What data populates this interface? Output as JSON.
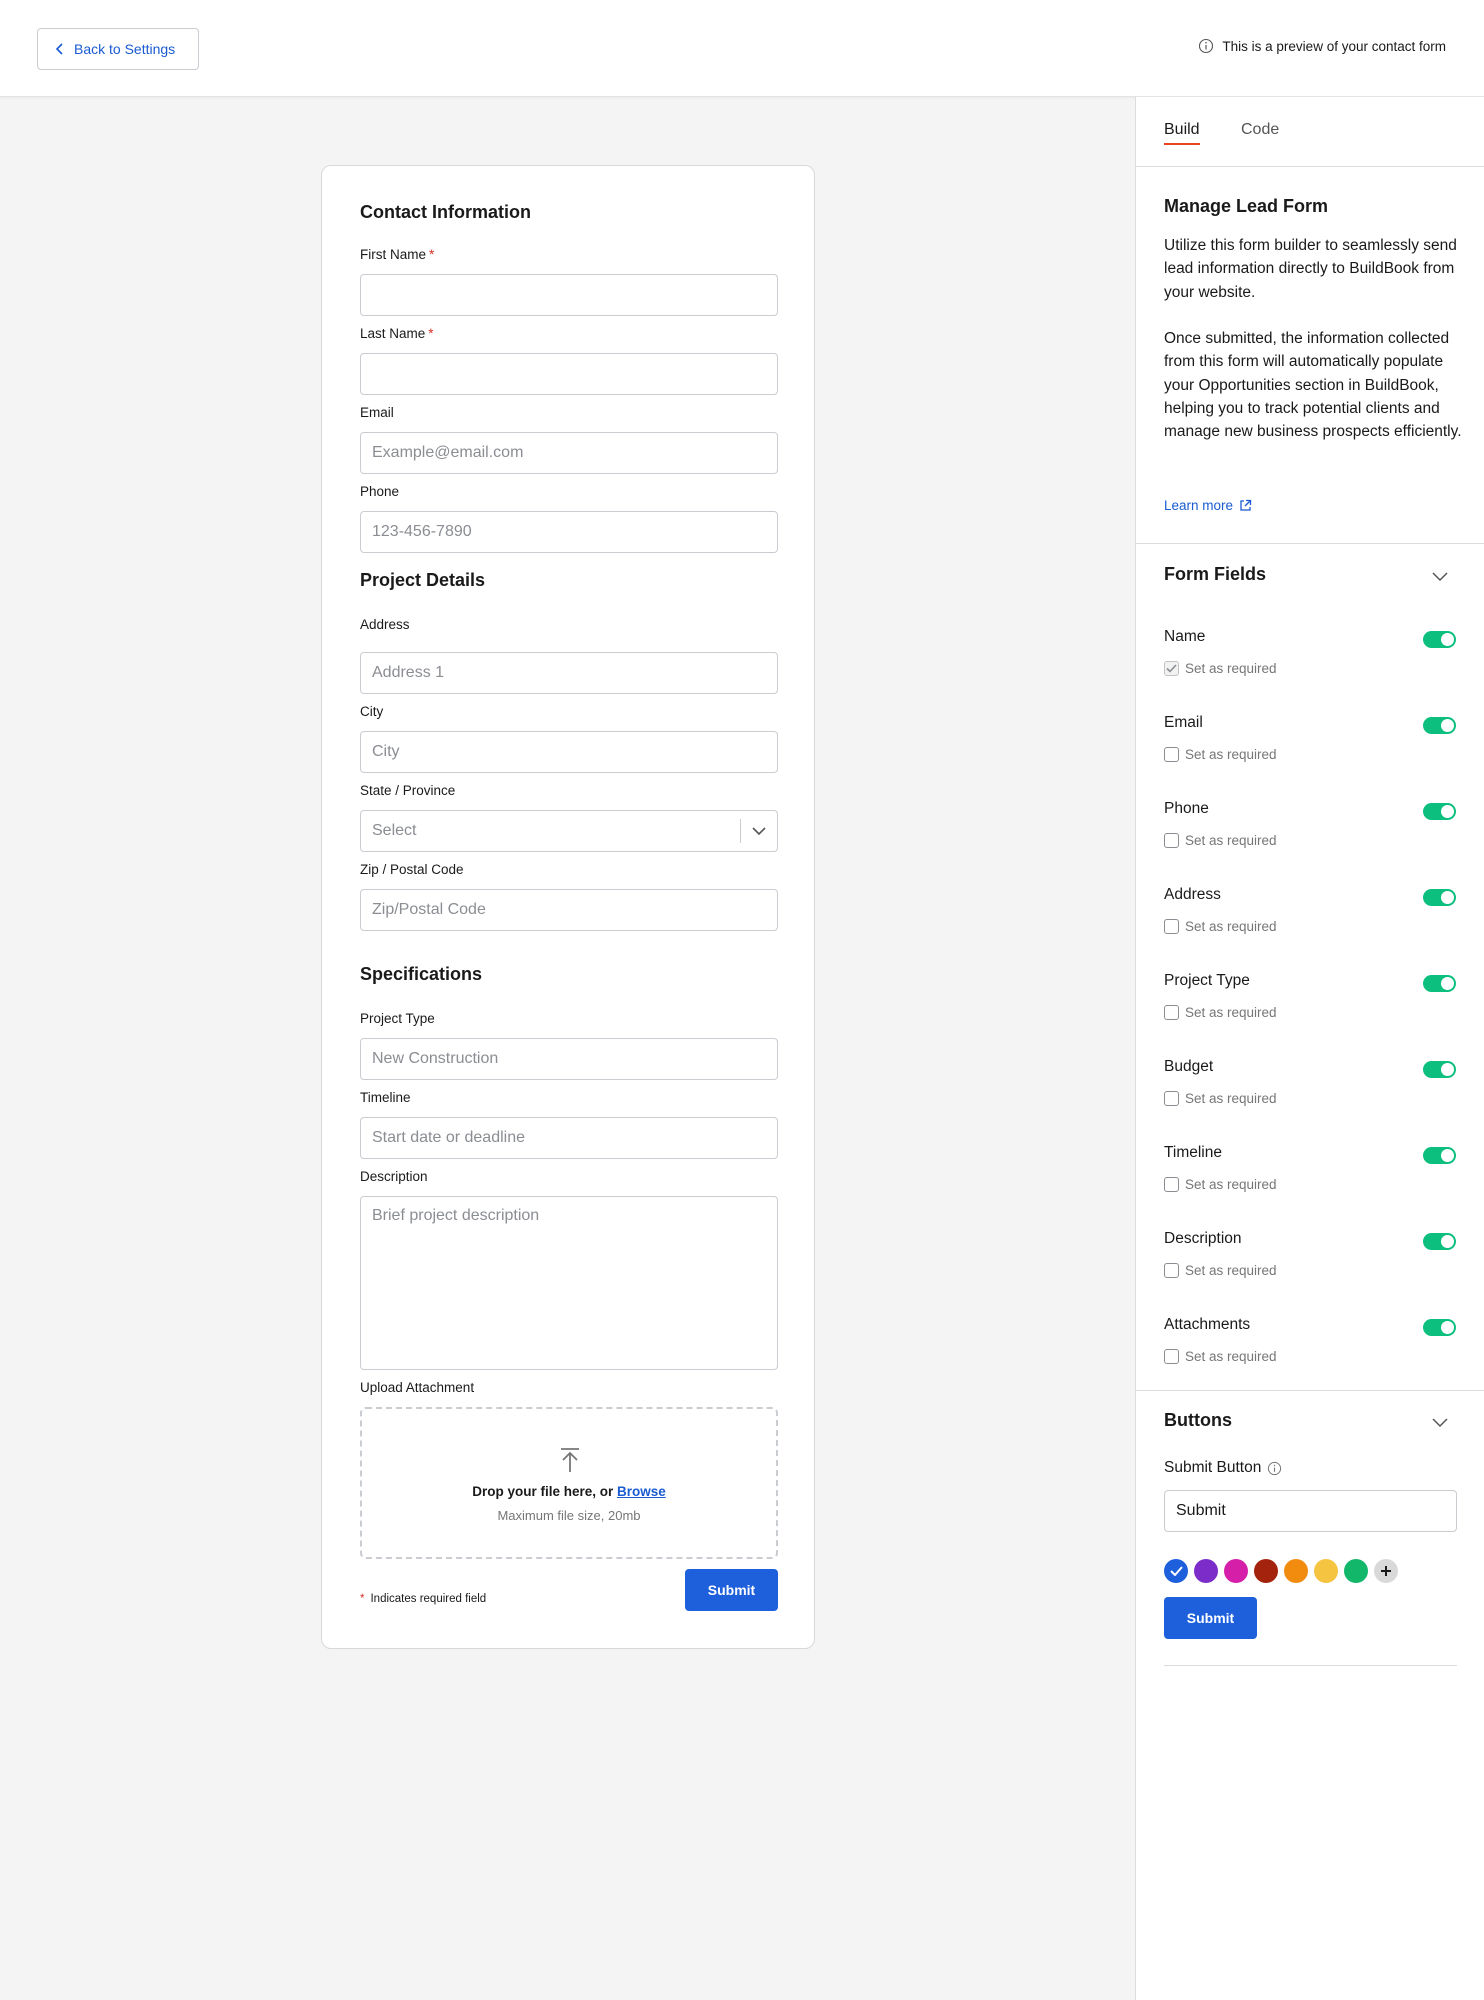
{
  "header": {
    "back_label": "Back to Settings",
    "preview_note": "This is a preview of your contact form"
  },
  "form": {
    "contact_title": "Contact Information",
    "first_name_label": "First Name",
    "last_name_label": "Last Name",
    "required_mark": "*",
    "email_label": "Email",
    "email_placeholder": "Example@email.com",
    "phone_label": "Phone",
    "phone_placeholder": "123-456-7890",
    "project_title": "Project Details",
    "address_label": "Address",
    "address_placeholder": "Address 1",
    "city_label": "City",
    "city_placeholder": "City",
    "state_label": "State / Province",
    "state_value": "Select",
    "zip_label": "Zip / Postal Code",
    "zip_placeholder": "Zip/Postal Code",
    "spec_title": "Specifications",
    "project_type_label": "Project Type",
    "project_type_placeholder": "New Construction",
    "timeline_label": "Timeline",
    "timeline_placeholder": "Start date or deadline",
    "description_label": "Description",
    "description_placeholder": "Brief project description",
    "upload_label": "Upload Attachment",
    "drop_text": "Drop your file here, or",
    "browse_link": "Browse",
    "max_size": "Maximum file size, 20mb",
    "required_note": "Indicates required field",
    "submit_label": "Submit"
  },
  "panel": {
    "tabs": [
      {
        "label": "Build",
        "active": true
      },
      {
        "label": "Code",
        "active": false
      }
    ],
    "manage_title": "Manage Lead Form",
    "manage_p1": "Utilize this form builder to seamlessly send lead information directly to BuildBook from your website.",
    "manage_p2": "Once submitted, the information collected from this form will automatically populate your Opportunities section in BuildBook, helping you to track potential clients and manage new business prospects efficiently.",
    "learn_more": "Learn more",
    "form_fields_title": "Form Fields",
    "set_required_label": "Set as required",
    "fields": [
      {
        "name": "Name",
        "enabled": true,
        "required": true
      },
      {
        "name": "Email",
        "enabled": true,
        "required": false
      },
      {
        "name": "Phone",
        "enabled": true,
        "required": false
      },
      {
        "name": "Address",
        "enabled": true,
        "required": false
      },
      {
        "name": "Project Type",
        "enabled": true,
        "required": false
      },
      {
        "name": "Budget",
        "enabled": true,
        "required": false
      },
      {
        "name": "Timeline",
        "enabled": true,
        "required": false
      },
      {
        "name": "Description",
        "enabled": true,
        "required": false
      },
      {
        "name": "Attachments",
        "enabled": true,
        "required": false
      }
    ],
    "buttons_title": "Buttons",
    "submit_button_label": "Submit Button",
    "submit_button_value": "Submit",
    "swatches": [
      "#1e60dc",
      "#7b2cc9",
      "#d61fa8",
      "#a3230d",
      "#f28c0f",
      "#f5c542",
      "#12b76a"
    ],
    "selected_swatch": "#1e60dc",
    "preview_button_label": "Submit"
  },
  "colors": {
    "accent": "#1e60dc",
    "toggle_on": "#0cbf7f",
    "tab_underline": "#e8451d",
    "required": "#d93025"
  }
}
